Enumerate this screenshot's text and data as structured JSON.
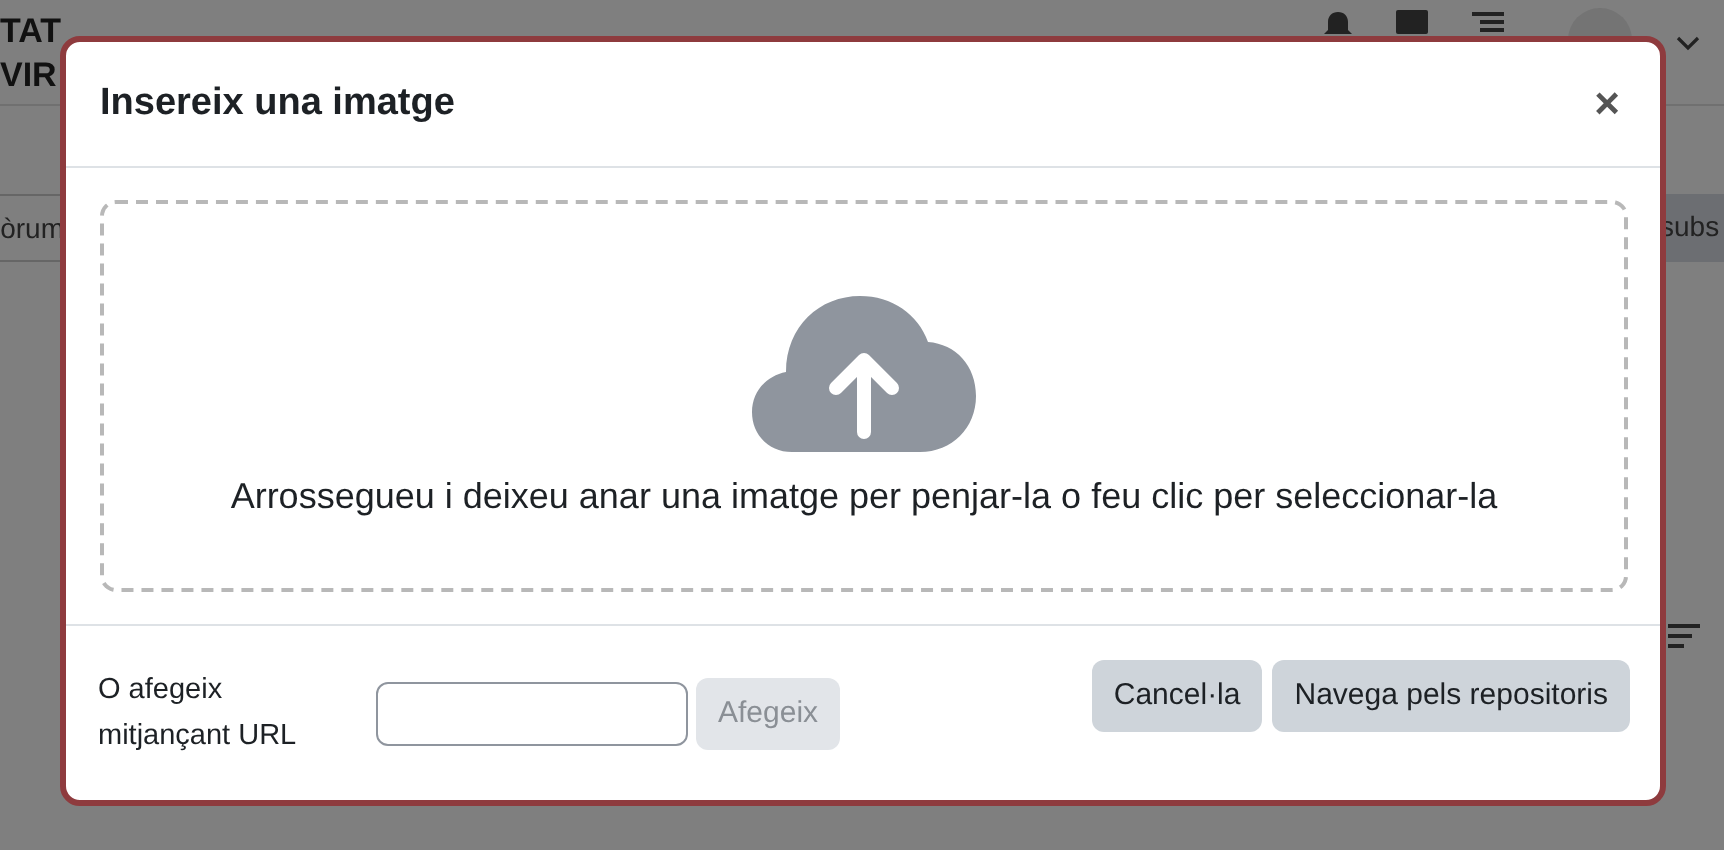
{
  "background": {
    "brand_lines": [
      "TAT",
      "VIR"
    ],
    "left_tab": "òrum",
    "right_button": "subs"
  },
  "dialog": {
    "title": "Insereix una imatge",
    "close": "×",
    "dropzone": {
      "message": "Arrossegueu i deixeu anar una imatge per penjar-la o feu clic per seleccionar-la"
    },
    "url_label": "O afegeix mitjançant URL",
    "add_button": {
      "label": "Afegeix",
      "disabled": true
    },
    "buttons": [
      {
        "label": "Cancel·la",
        "disabled": false
      },
      {
        "label": "Navega pels repositoris",
        "disabled": false
      }
    ]
  }
}
